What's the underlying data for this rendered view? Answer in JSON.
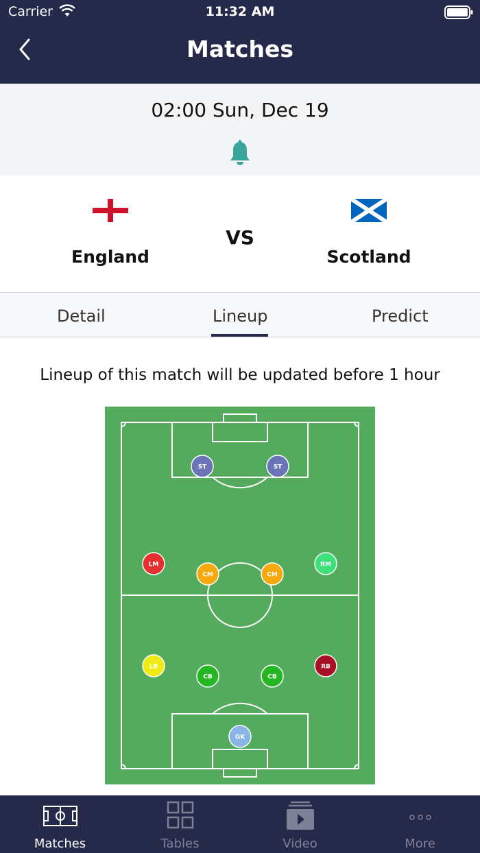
{
  "status_bar": {
    "carrier": "Carrier",
    "time": "11:32 AM"
  },
  "header": {
    "title": "Matches"
  },
  "match": {
    "datetime": "02:00 Sun, Dec 19",
    "home_team": "England",
    "away_team": "Scotland",
    "vs_label": "VS"
  },
  "tabs": [
    {
      "label": "Detail",
      "active": false
    },
    {
      "label": "Lineup",
      "active": true
    },
    {
      "label": "Predict",
      "active": false
    }
  ],
  "lineup": {
    "note": "Lineup of this match will be updated before 1 hour",
    "pitch_color": "#55ab5d",
    "players": [
      {
        "pos": "ST",
        "color": "#6b74b6"
      },
      {
        "pos": "ST",
        "color": "#6b74b6"
      },
      {
        "pos": "LM",
        "color": "#e62f2f"
      },
      {
        "pos": "CM",
        "color": "#f5a90c"
      },
      {
        "pos": "CM",
        "color": "#f5a90c"
      },
      {
        "pos": "RM",
        "color": "#3ee07a"
      },
      {
        "pos": "LB",
        "color": "#f0ec13"
      },
      {
        "pos": "CB",
        "color": "#25b624"
      },
      {
        "pos": "CB",
        "color": "#25b624"
      },
      {
        "pos": "RB",
        "color": "#a80f25"
      },
      {
        "pos": "GK",
        "color": "#88b4e6"
      }
    ]
  },
  "bottom_nav": [
    {
      "label": "Matches",
      "icon": "pitch-icon",
      "active": true
    },
    {
      "label": "Tables",
      "icon": "grid-icon",
      "active": false
    },
    {
      "label": "Video",
      "icon": "video-icon",
      "active": false
    },
    {
      "label": "More",
      "icon": "more-icon",
      "active": false
    }
  ],
  "colors": {
    "brand": "#262a4a",
    "accent_bell": "#3aa59a",
    "flag_red": "#d0112b",
    "flag_blue": "#0065bd"
  }
}
